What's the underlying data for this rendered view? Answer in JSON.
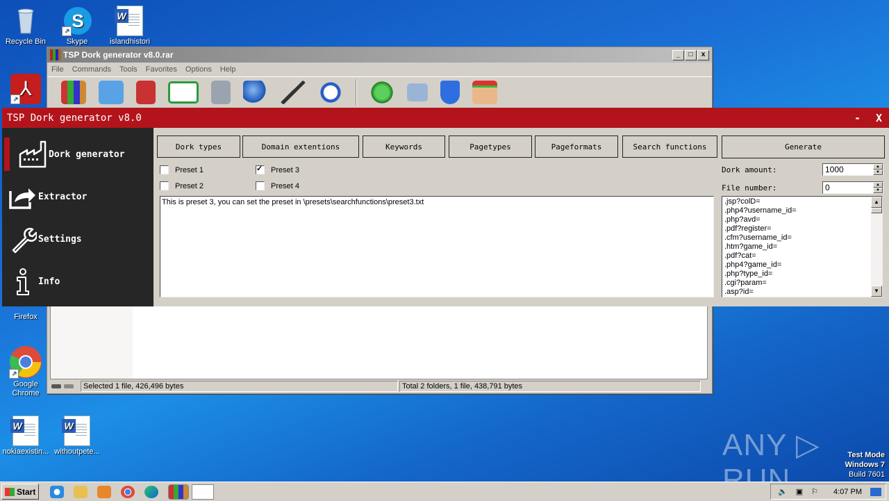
{
  "desktop": {
    "icons": [
      {
        "label": "Recycle Bin",
        "icon": "recycle-bin-icon"
      },
      {
        "label": "Skype",
        "icon": "skype-icon"
      },
      {
        "label": "islandhistori",
        "icon": "word-document-icon"
      },
      {
        "label": "",
        "icon": "acrobat-reader-icon"
      },
      {
        "label": "Firefox",
        "icon": "firefox-icon"
      },
      {
        "label": "Google Chrome",
        "icon": "chrome-icon"
      },
      {
        "label": "nokiaexistin...",
        "icon": "word-document-icon"
      },
      {
        "label": "withoutpete...",
        "icon": "word-document-icon"
      }
    ],
    "watermark": "ANY ▷ RUN",
    "test_mode": {
      "line1": "Test Mode",
      "line2": "Windows 7",
      "line3": "Build 7601"
    }
  },
  "rar_window": {
    "title": "TSP Dork generator v8.0.rar",
    "menu": [
      "File",
      "Commands",
      "Tools",
      "Favorites",
      "Options",
      "Help"
    ],
    "toolbar": [
      "add-icon",
      "extract-icon",
      "test-icon",
      "view-icon",
      "delete-icon",
      "find-icon",
      "wizard-icon",
      "info-icon",
      "virus-scan-icon",
      "comment-icon",
      "protect-icon",
      "sfx-icon"
    ],
    "status_left": "Selected 1 file, 426,496 bytes",
    "status_right": "Total 2 folders, 1 file, 438,791 bytes"
  },
  "app": {
    "title": "TSP Dork generator v8.0",
    "minimize": "-",
    "close": "X",
    "accent": "#b3141b",
    "sidebar": [
      {
        "label": "Dork generator",
        "active": true
      },
      {
        "label": "Extractor",
        "active": false
      },
      {
        "label": "Settings",
        "active": false
      },
      {
        "label": "Info",
        "active": false
      }
    ],
    "tabs": [
      "Dork types",
      "Domain extentions",
      "Keywords",
      "Pagetypes",
      "Pageformats",
      "Search functions"
    ],
    "generate_label": "Generate",
    "presets": [
      {
        "label": "Preset 1",
        "checked": false
      },
      {
        "label": "Preset 2",
        "checked": false
      },
      {
        "label": "Preset 3",
        "checked": true
      },
      {
        "label": "Preset 4",
        "checked": false
      }
    ],
    "preset_text": "This is preset 3, you can set the preset in \\presets\\searchfunctions\\preset3.txt",
    "dork_amount_label": "Dork amount:",
    "dork_amount": "1000",
    "file_number_label": "File number:",
    "file_number": "0",
    "output_list": [
      ".jsp?colD=",
      ".php4?username_id=",
      ".php?avd=",
      ".pdf?register=",
      ".cfm?username_id=",
      ".htm?game_id=",
      ".pdf?cat=",
      ".php4?game_id=",
      ".php?type_id=",
      ".cgi?param=",
      ".asp?id="
    ]
  },
  "taskbar": {
    "start": "Start",
    "apps": [
      "ie-icon",
      "explorer-icon",
      "media-player-icon",
      "chrome-icon",
      "edge-icon",
      "winrar-icon",
      "dork-generator-icon"
    ],
    "clock": "4:07 PM"
  }
}
